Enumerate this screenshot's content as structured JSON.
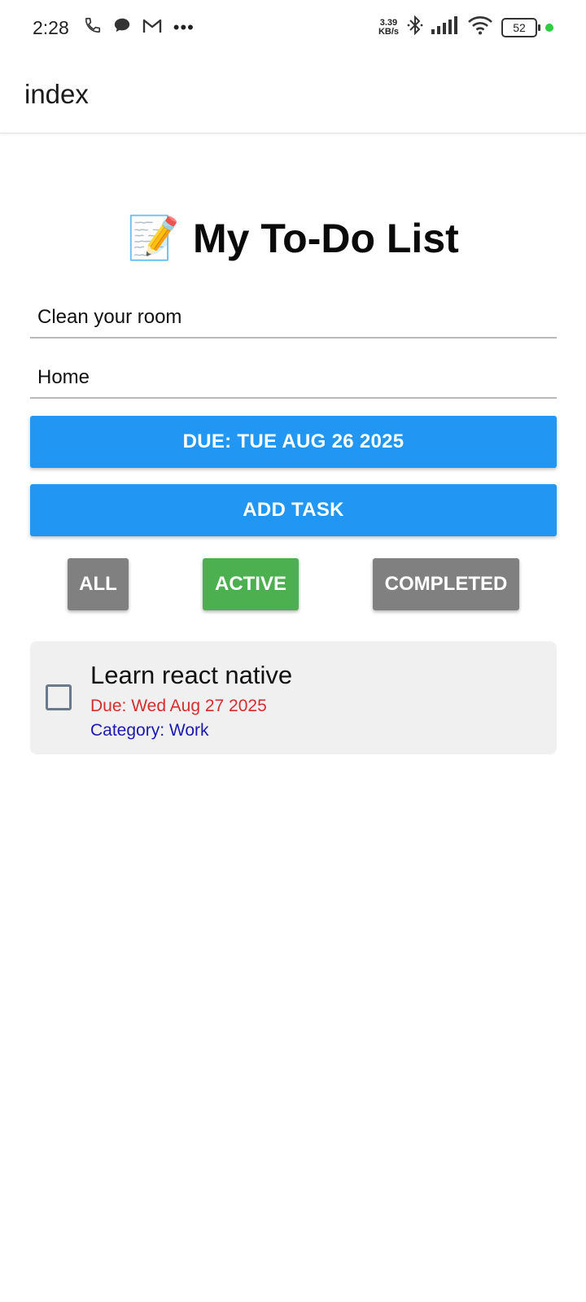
{
  "status_bar": {
    "time": "2:28",
    "net_speed_value": "3.39",
    "net_speed_unit": "KB/s",
    "battery_level": "52",
    "left_icons": [
      "phone-icon",
      "chat-bubble-icon",
      "gmail-icon",
      "more-dots-icon"
    ],
    "right_icons": [
      "bluetooth-icon",
      "signal-icon",
      "wifi-icon",
      "battery-icon"
    ]
  },
  "header": {
    "title": "index"
  },
  "main": {
    "title_icon": "📝",
    "title": "My To-Do List",
    "task_input": {
      "value": "Clean your room"
    },
    "category_input": {
      "value": "Home"
    },
    "due_button_label": "DUE: TUE AUG 26 2025",
    "add_task_label": "ADD TASK",
    "filters": [
      {
        "label": "ALL",
        "color": "#808080",
        "selected": false
      },
      {
        "label": "ACTIVE",
        "color": "#4caf50",
        "selected": true
      },
      {
        "label": "COMPLETED",
        "color": "#808080",
        "selected": false
      }
    ],
    "tasks": [
      {
        "title": "Learn react native",
        "due": "Due: Wed Aug 27 2025",
        "category": "Category: Work",
        "completed": false
      }
    ]
  },
  "colors": {
    "primary": "#2196f3",
    "active_filter": "#4caf50",
    "inactive_filter": "#808080",
    "due_text": "#d32f2f",
    "category_text": "#1a1ab0",
    "card_bg": "#f0f0f0"
  }
}
